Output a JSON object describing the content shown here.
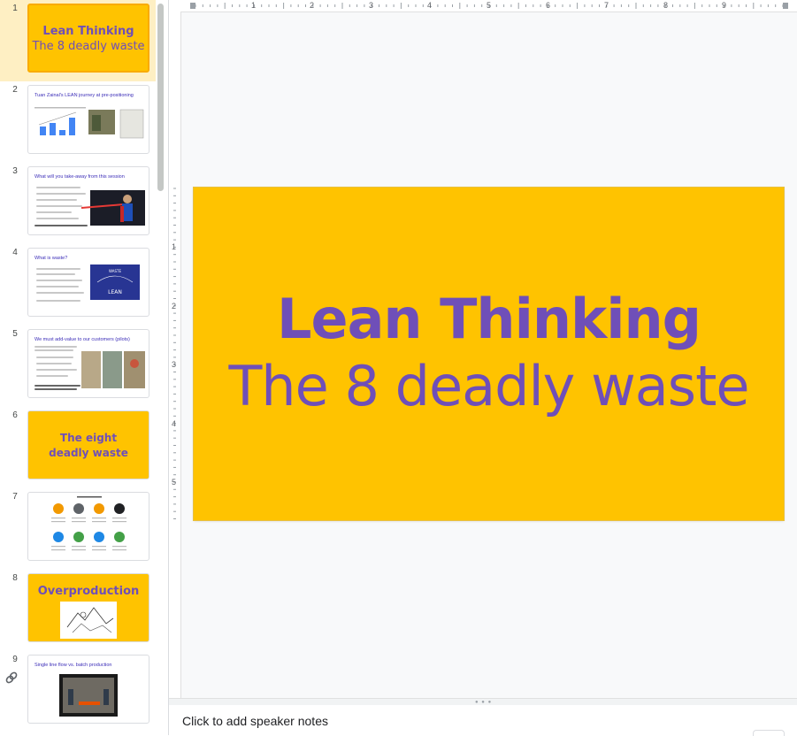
{
  "filmstrip": {
    "slides": [
      {
        "num": "1",
        "title": "Lean Thinking",
        "subtitle": "The 8 deadly waste"
      },
      {
        "num": "2",
        "title": "Tuan Zainal's LEAN journey at pre-positioning"
      },
      {
        "num": "3",
        "title": "What will you take-away from this session"
      },
      {
        "num": "4",
        "title": "What is waste?",
        "picture_text": [
          "WASTE",
          "LEAN"
        ]
      },
      {
        "num": "5",
        "title": "We must add-value to our customers (pilots)"
      },
      {
        "num": "6",
        "title": "The eight deadly waste"
      },
      {
        "num": "7"
      },
      {
        "num": "8",
        "title": "Overproduction"
      },
      {
        "num": "9",
        "title": "Single line flow vs. batch production"
      }
    ]
  },
  "rulers": {
    "horizontal": [
      "1",
      "2",
      "3",
      "4",
      "5",
      "6",
      "7",
      "8",
      "9"
    ],
    "vertical": [
      "1",
      "2",
      "3",
      "4",
      "5"
    ]
  },
  "slide": {
    "title": "Lean Thinking",
    "subtitle": "The 8 deadly waste",
    "background": "#ffc300",
    "text_color": "#6f4fb8"
  },
  "notes": {
    "placeholder": "Click to add speaker notes"
  },
  "icons": {
    "sidebar_bottom": "link-icon"
  }
}
